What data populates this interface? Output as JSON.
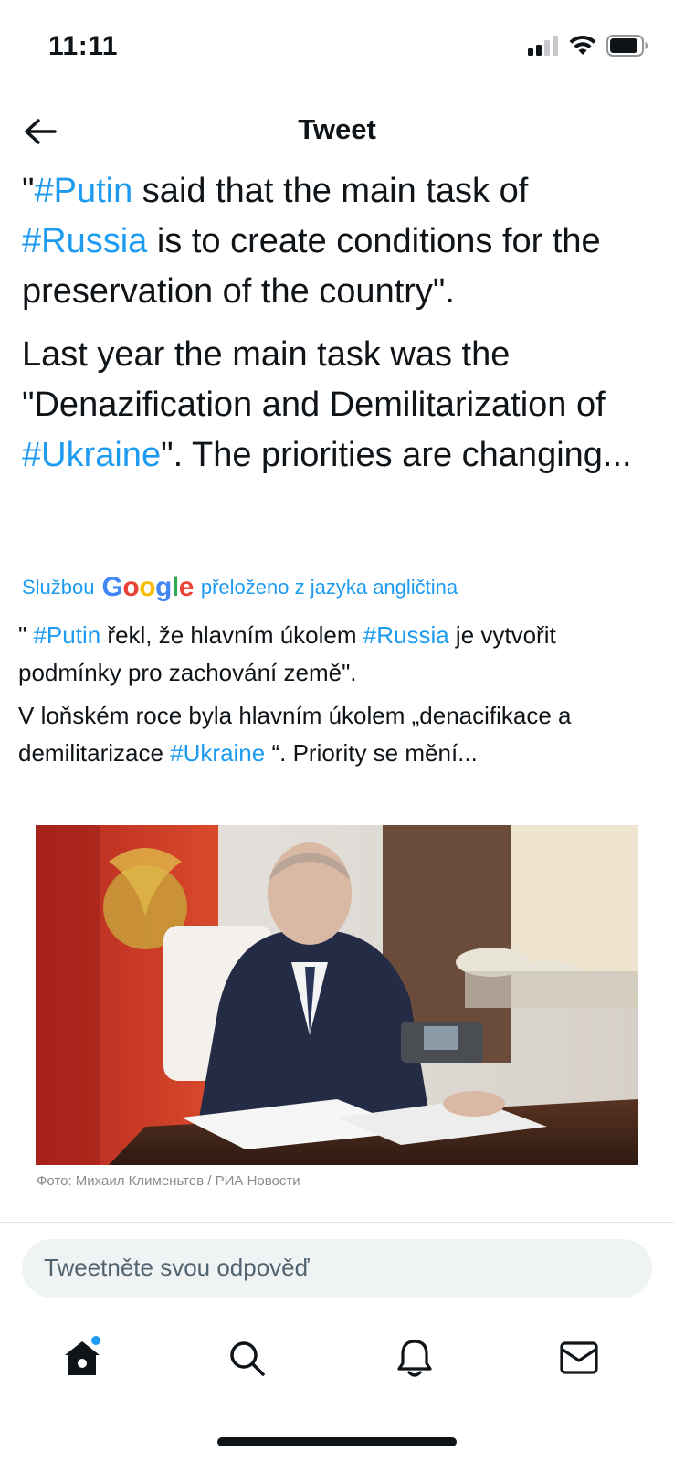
{
  "status_bar": {
    "time": "11:11",
    "icons": [
      "signal-icon",
      "wifi-icon",
      "battery-icon"
    ]
  },
  "nav": {
    "title": "Tweet",
    "back_icon": "arrow-left-icon"
  },
  "tweet": {
    "para1": {
      "q": "\"",
      "tag1": "#Putin",
      "t1": " said that the main task of ",
      "tag2": "#Russia",
      "t2": " is to create conditions for the preservation of the country\"."
    },
    "para2": {
      "t1": "Last year the main task was the \"Denazification and Demilitarization of ",
      "tag1": "#Ukraine",
      "t2": "\". The priorities are changing..."
    }
  },
  "translation": {
    "prefix": "Službou",
    "google": "Google",
    "suffix": "přeloženo z jazyka angličtina",
    "para1": {
      "q": "\" ",
      "tag1": "#Putin",
      "t1": " řekl, že hlavním úkolem ",
      "tag2": "#Russia",
      "t2": " je vytvořit podmínky pro zachování země\"."
    },
    "para2": {
      "t1": "V loňském roce byla hlavním úkolem „denacifikace a demilitarizace ",
      "tag1": "#Ukraine",
      "t2": " “. Priority se mění..."
    }
  },
  "media": {
    "caption": "Фото: Михаил Клименьтев / РИА Новости"
  },
  "reply": {
    "placeholder": "Tweetněte svou odpověď"
  },
  "tab_bar": {
    "items": [
      "home-icon",
      "search-icon",
      "bell-icon",
      "mail-icon"
    ],
    "home_has_badge": true
  },
  "colors": {
    "accent": "#1d9bf0",
    "text": "#0f1419",
    "muted": "#536471"
  }
}
